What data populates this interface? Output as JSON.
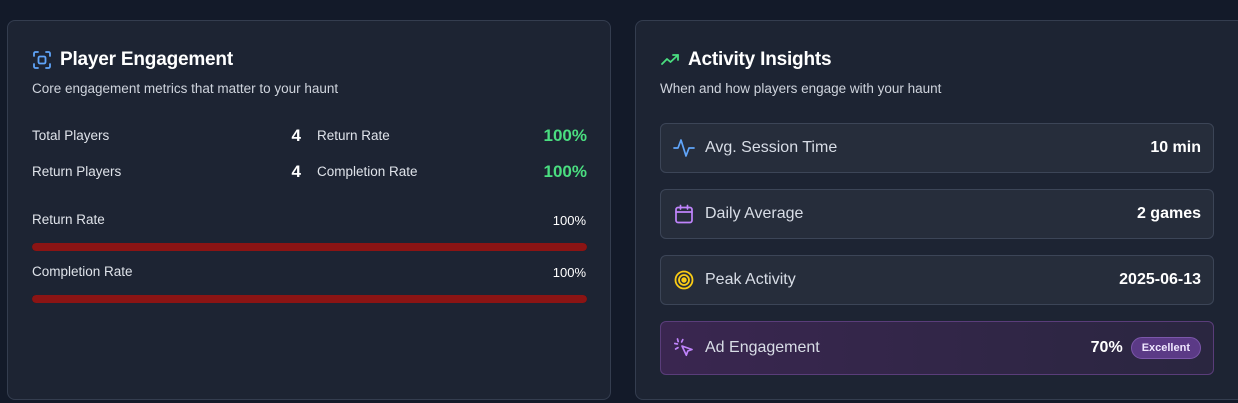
{
  "player_engagement": {
    "title": "Player Engagement",
    "subtitle": "Core engagement metrics that matter to your haunt",
    "metrics": [
      {
        "label": "Total Players",
        "value": "4"
      },
      {
        "label": "Return Rate",
        "value": "100%"
      },
      {
        "label": "Return Players",
        "value": "4"
      },
      {
        "label": "Completion Rate",
        "value": "100%"
      }
    ],
    "bars": [
      {
        "label": "Return Rate",
        "pct_text": "100%",
        "percent": 100
      },
      {
        "label": "Completion Rate",
        "pct_text": "100%",
        "percent": 100
      }
    ]
  },
  "activity_insights": {
    "title": "Activity Insights",
    "subtitle": "When and how players engage with your haunt",
    "rows": [
      {
        "label": "Avg. Session Time",
        "value": "10 min",
        "icon": "activity-pulse-icon"
      },
      {
        "label": "Daily Average",
        "value": "2 games",
        "icon": "calendar-icon"
      },
      {
        "label": "Peak Activity",
        "value": "2025-06-13",
        "icon": "target-icon"
      },
      {
        "label": "Ad Engagement",
        "value": "70%",
        "badge": "Excellent",
        "icon": "cursor-click-icon"
      }
    ]
  },
  "colors": {
    "green": "#4ade80",
    "bar": "#8b1414",
    "blue_icon": "#60a5fa",
    "purple_icon": "#c084fc",
    "yellow_icon": "#facc15",
    "trend_green": "#4ade80"
  }
}
